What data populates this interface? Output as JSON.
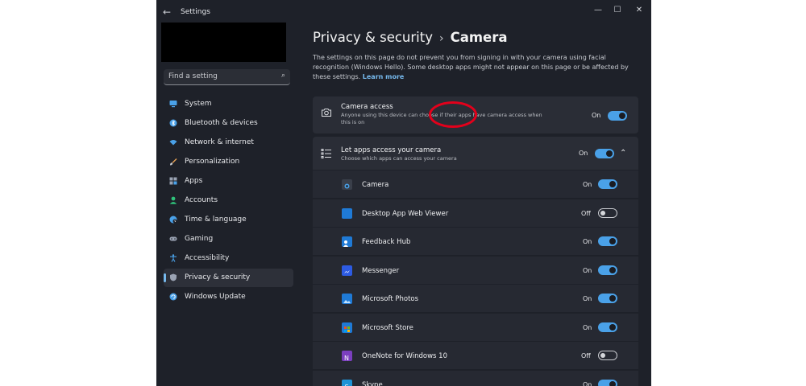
{
  "titlebar": {
    "app_title": "Settings",
    "back_glyph": "←",
    "minimize_glyph": "—",
    "maximize_glyph": "☐",
    "close_glyph": "✕"
  },
  "search": {
    "placeholder": "Find a setting"
  },
  "sidebar": {
    "items": [
      {
        "label": "System",
        "icon": "monitor-icon",
        "color": "#4aa1e8"
      },
      {
        "label": "Bluetooth & devices",
        "icon": "bluetooth-icon",
        "color": "#4aa1e8"
      },
      {
        "label": "Network & internet",
        "icon": "wifi-icon",
        "color": "#4aa1e8"
      },
      {
        "label": "Personalization",
        "icon": "brush-icon",
        "color": "#e8a255"
      },
      {
        "label": "Apps",
        "icon": "apps-icon",
        "color": "#9aa3b3"
      },
      {
        "label": "Accounts",
        "icon": "person-icon",
        "color": "#2fc27b"
      },
      {
        "label": "Time & language",
        "icon": "globe-clock-icon",
        "color": "#4aa1e8"
      },
      {
        "label": "Gaming",
        "icon": "gamepad-icon",
        "color": "#9aa3b3"
      },
      {
        "label": "Accessibility",
        "icon": "accessibility-icon",
        "color": "#4aa1e8"
      },
      {
        "label": "Privacy & security",
        "icon": "shield-icon",
        "color": "#9aa3b3",
        "selected": true
      },
      {
        "label": "Windows Update",
        "icon": "update-icon",
        "color": "#4aa1e8"
      }
    ]
  },
  "header": {
    "parent": "Privacy & security",
    "separator": "›",
    "current": "Camera"
  },
  "description": {
    "text": "The settings on this page do not prevent you from signing in with your camera using facial recognition (Windows Hello). Some desktop apps might not appear on this page or be affected by these settings.",
    "link": "Learn more"
  },
  "camera_access": {
    "title": "Camera access",
    "subtitle": "Anyone using this device can choose if their apps have camera access when this is on",
    "state": "On",
    "on": true,
    "icon": "camera-icon"
  },
  "let_apps": {
    "title": "Let apps access your camera",
    "subtitle": "Choose which apps can access your camera",
    "state": "On",
    "on": true,
    "icon": "list-icon",
    "expand_glyph": "⌃"
  },
  "apps": [
    {
      "name": "Camera",
      "state": "On",
      "on": true,
      "icon": "camera-app-icon",
      "color": "#3a3f4a"
    },
    {
      "name": "Desktop App Web Viewer",
      "state": "Off",
      "on": false,
      "icon": "webviewer-icon",
      "color": "#1f7ad6"
    },
    {
      "name": "Feedback Hub",
      "state": "On",
      "on": true,
      "icon": "feedback-hub-icon",
      "color": "#1f7ad6"
    },
    {
      "name": "Messenger",
      "state": "On",
      "on": true,
      "icon": "messenger-icon",
      "color": "#2d5be3"
    },
    {
      "name": "Microsoft Photos",
      "state": "On",
      "on": true,
      "icon": "photos-icon",
      "color": "#1f7ad6"
    },
    {
      "name": "Microsoft Store",
      "state": "On",
      "on": true,
      "icon": "store-icon",
      "color": "#1f7ad6"
    },
    {
      "name": "OneNote for Windows 10",
      "state": "Off",
      "on": false,
      "icon": "onenote-icon",
      "color": "#7b3fbf"
    },
    {
      "name": "Skype",
      "state": "On",
      "on": true,
      "icon": "skype-icon",
      "color": "#1e93d6"
    }
  ],
  "colors": {
    "accent": "#4aa1e8",
    "highlight_circle": "#e3001b",
    "window_bg": "#1e2129",
    "card_bg": "#2a2d36"
  }
}
